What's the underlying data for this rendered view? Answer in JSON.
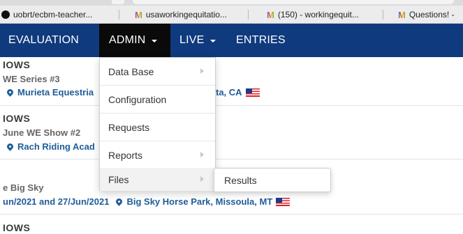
{
  "bookmarks": [
    {
      "icon": "github-icon",
      "label": "uobrt/ecbm-teacher..."
    },
    {
      "icon": "gmail-icon",
      "label": "usaworkingequitatio..."
    },
    {
      "icon": "gmail-icon",
      "label": "(150) - workingequit..."
    },
    {
      "icon": "gmail-icon",
      "label": "Questions! -"
    }
  ],
  "nav": {
    "evaluation": "EVALUATION",
    "admin": "ADMIN",
    "live": "LIVE",
    "entries": "ENTRIES"
  },
  "admin_menu": [
    {
      "label": "Data Base",
      "has_submenu": true
    },
    {
      "label": "Configuration",
      "has_submenu": false
    },
    {
      "label": "Requests",
      "has_submenu": false
    },
    {
      "label": "Reports",
      "has_submenu": true
    },
    {
      "label": "Files",
      "has_submenu": true
    }
  ],
  "files_submenu": {
    "label": "Results"
  },
  "shows": [
    {
      "header": "IOWS",
      "subtitle": "WE Series #3",
      "location": "Murieta Equestria",
      "location_tail": "ta, CA"
    },
    {
      "header": "IOWS",
      "subtitle": "June WE Show #2",
      "location": "Rach Riding Acad",
      "location_tail": ""
    },
    {
      "header": "",
      "subtitle": "e Big Sky",
      "dates": "un/2021 and 27/Jun/2021",
      "location": "Big Sky Horse Park, Missoula, MT"
    },
    {
      "header": "IOWS",
      "subtitle": "",
      "location": "",
      "location_tail": ""
    }
  ],
  "colors": {
    "navbar": "#0f3a7d",
    "active_nav": "#0a0a0a",
    "location_text": "#1f5d99"
  }
}
